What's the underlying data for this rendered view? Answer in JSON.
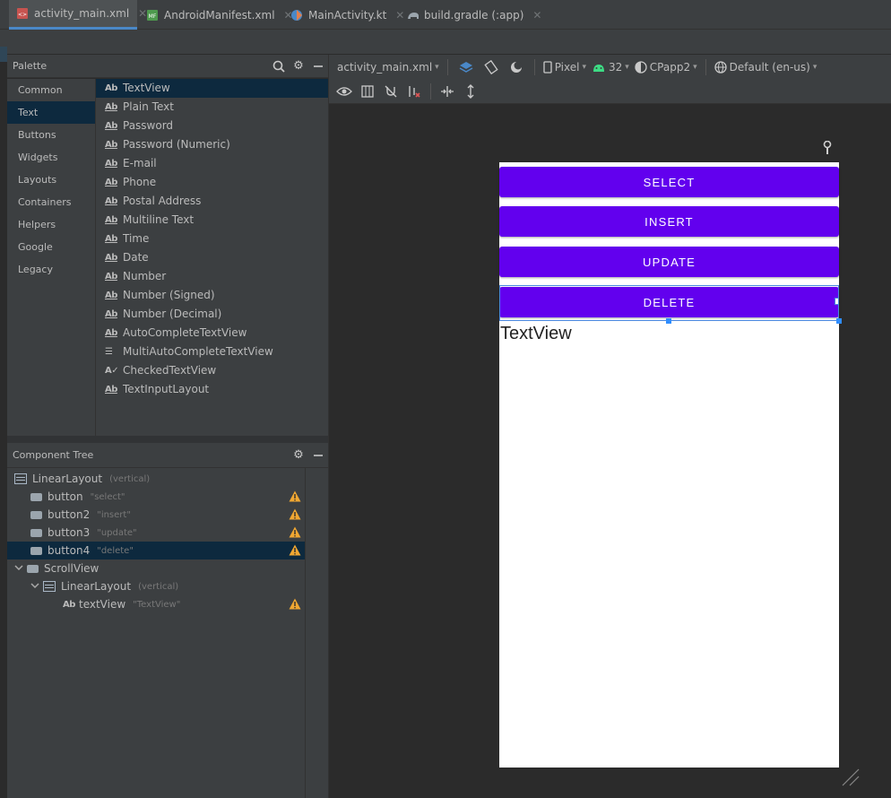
{
  "tabs": [
    {
      "label": "activity_main.xml",
      "active": true,
      "icon": "xml-file-icon"
    },
    {
      "label": "AndroidManifest.xml",
      "active": false,
      "icon": "manifest-file-icon"
    },
    {
      "label": "MainActivity.kt",
      "active": false,
      "icon": "kotlin-file-icon"
    },
    {
      "label": "build.gradle (:app)",
      "active": false,
      "icon": "gradle-file-icon"
    }
  ],
  "palette": {
    "title": "Palette",
    "categories": [
      "Common",
      "Text",
      "Buttons",
      "Widgets",
      "Layouts",
      "Containers",
      "Helpers",
      "Google",
      "Legacy"
    ],
    "selected_category": "Text",
    "widgets": [
      "TextView",
      "Plain Text",
      "Password",
      "Password (Numeric)",
      "E-mail",
      "Phone",
      "Postal Address",
      "Multiline Text",
      "Time",
      "Date",
      "Number",
      "Number (Signed)",
      "Number (Decimal)",
      "AutoCompleteTextView",
      "MultiAutoCompleteTextView",
      "CheckedTextView",
      "TextInputLayout"
    ],
    "selected_widget": "TextView"
  },
  "component_tree": {
    "title": "Component Tree",
    "nodes": [
      {
        "label": "LinearLayout",
        "sub": "(vertical)"
      },
      {
        "label": "button",
        "sub": "\"select\""
      },
      {
        "label": "button2",
        "sub": "\"insert\""
      },
      {
        "label": "button3",
        "sub": "\"update\""
      },
      {
        "label": "button4",
        "sub": "\"delete\""
      },
      {
        "label": "ScrollView",
        "sub": ""
      },
      {
        "label": "LinearLayout",
        "sub": "(vertical)"
      },
      {
        "label": "textView",
        "sub": "\"TextView\""
      }
    ]
  },
  "toolbar": {
    "file": "activity_main.xml",
    "device": "Pixel",
    "api": "32",
    "theme": "CPapp2",
    "locale": "Default (en-us)"
  },
  "device_screen": {
    "buttons": [
      "SELECT",
      "INSERT",
      "UPDATE",
      "DELETE"
    ],
    "textview": "TextView"
  },
  "colors": {
    "accent_button": "#6200ee",
    "selection": "#0d293e",
    "warning": "#f0a732"
  }
}
